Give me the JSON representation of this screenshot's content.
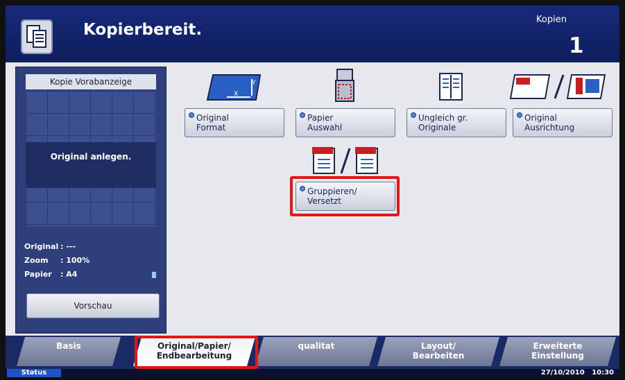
{
  "header": {
    "title": "Kopierbereit.",
    "copies_label": "Kopien",
    "copies_count": "1"
  },
  "preview": {
    "title": "Kopie Vorabanzeige",
    "placeholder": "Original anlegen.",
    "info": [
      {
        "label": "Original",
        "value": ": ---"
      },
      {
        "label": "Zoom",
        "value": ": 100%"
      },
      {
        "label": "Papier",
        "value": ": A4"
      }
    ],
    "preview_button": "Vorschau"
  },
  "options": [
    {
      "line1": "Original",
      "line2": "Format",
      "icon": "original-format-icon"
    },
    {
      "line1": "Papier",
      "line2": "Auswahl",
      "icon": "paper-selection-icon"
    },
    {
      "line1": "Ungleich gr.",
      "line2": "Originale",
      "icon": "mixed-size-originals-icon"
    },
    {
      "line1": "Original",
      "line2": "Ausrichtung",
      "icon": "original-orientation-icon"
    },
    {
      "line1": "Gruppieren/",
      "line2": "Versetzt",
      "icon": "collate-offset-icon",
      "highlighted": true
    }
  ],
  "tabs": [
    {
      "line1": "Basis",
      "line2": ""
    },
    {
      "line1": "Original/Papier/",
      "line2": "Endbearbeitung",
      "active": true
    },
    {
      "line1": "qualitat",
      "line2": ""
    },
    {
      "line1": "Layout/",
      "line2": "Bearbeiten"
    },
    {
      "line1": "Erweiterte",
      "line2": "Einstellung"
    }
  ],
  "status": {
    "button": "Status",
    "date": "27/10/2010",
    "time": "10:30"
  },
  "colors": {
    "highlight": "#e01818",
    "header_bg": "#17297a",
    "accent_dot": "#4f83d6"
  }
}
